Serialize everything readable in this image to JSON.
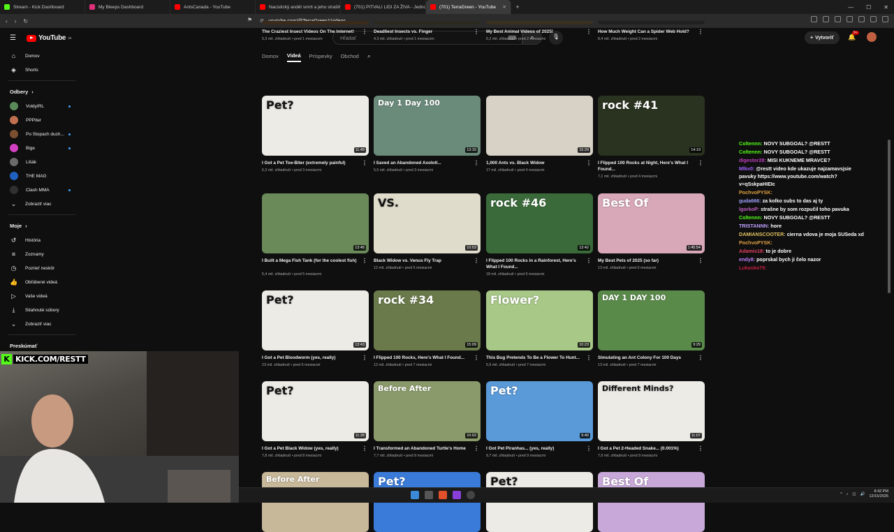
{
  "browser": {
    "tabs": [
      {
        "title": "Stream - Kick Dashboard",
        "color": "#53fc18"
      },
      {
        "title": "My Bleeps Dashboard",
        "color": "#e0307a"
      },
      {
        "title": "AntsCanada - YouTube",
        "color": "#ff0000"
      },
      {
        "title": "Nacistický anděl smrti a jeho strašlivé",
        "color": "#ff0000"
      },
      {
        "title": "(701) PITVALI LIDI ZA ŽIVA - Jednotk",
        "color": "#ff0000"
      },
      {
        "title": "(701) TerraGreen - YouTube",
        "color": "#ff0000",
        "active": true
      }
    ],
    "url": "youtube.com/@TerraGreen1/videos"
  },
  "youtube": {
    "logo_text": "YouTube",
    "logo_region": "SK",
    "search_placeholder": "Hľadať",
    "create_label": "Vytvoriť",
    "notif_count": "9+"
  },
  "sidebar": {
    "top": [
      {
        "label": "Domov",
        "icon": "home-icon",
        "glyph": "⌂"
      },
      {
        "label": "Shorts",
        "icon": "shorts-icon",
        "glyph": "◈"
      }
    ],
    "subs_header": "Odbery",
    "subs": [
      {
        "label": "VoldyIRL",
        "color": "#5a8a5a",
        "dot": true
      },
      {
        "label": "PPPiter",
        "color": "#c07050",
        "dot": false
      },
      {
        "label": "Po Stopach duch...",
        "color": "#7a5030",
        "dot": true
      },
      {
        "label": "Bige",
        "color": "#d040c0",
        "dot": true
      },
      {
        "label": "Lišák",
        "color": "#6a6a6a",
        "dot": false
      },
      {
        "label": "THE MAG",
        "color": "#2060c0",
        "dot": false
      },
      {
        "label": "Clash MMA",
        "color": "#303030",
        "dot": true
      }
    ],
    "show_more": "Zobraziť viac",
    "mine_header": "Moje",
    "mine": [
      {
        "label": "História",
        "icon": "history-icon",
        "glyph": "↺"
      },
      {
        "label": "Zoznamy",
        "icon": "playlists-icon",
        "glyph": "≡"
      },
      {
        "label": "Pozrieť neskôr",
        "icon": "watch-later-icon",
        "glyph": "◷"
      },
      {
        "label": "Obľúbené videá",
        "icon": "liked-icon",
        "glyph": "👍"
      },
      {
        "label": "Vaše videá",
        "icon": "your-videos-icon",
        "glyph": "▷"
      },
      {
        "label": "Stiahnuté súbory",
        "icon": "downloads-icon",
        "glyph": "⤓"
      }
    ],
    "show_more2": "Zobraziť viac",
    "explore_header": "Preskúmať"
  },
  "channel_tabs": [
    "Domov",
    "Videá",
    "Príspevky",
    "Obchod"
  ],
  "videos": [
    {
      "title": "The Craziest Insect Videos On The Internet!",
      "views": "5,3 mil. zhliadnutí",
      "age": "pred 1 mesiacom",
      "duration": "",
      "thumb_bg": "#3a2a1a",
      "thumb_text": ""
    },
    {
      "title": "Deadliest Insects vs. Finger",
      "views": "4,3 mil. zhliadnutí",
      "age": "pred 1 mesiacom",
      "duration": "",
      "thumb_bg": "#2a2a20",
      "thumb_text": ""
    },
    {
      "title": "My Best Animal Videos of 2025!",
      "views": "6,2 mil. zhliadnutí",
      "age": "pred 2 mesiacmi",
      "duration": "",
      "thumb_bg": "#3a3020",
      "thumb_text": ""
    },
    {
      "title": "How Much Weight Can a Spider Web Hold?",
      "views": "8,4 mil. zhliadnutí",
      "age": "pred 2 mesiacmi",
      "duration": "",
      "thumb_bg": "#202020",
      "thumb_text": ""
    },
    {
      "title": "I Got a Pet Toe-Biter (extremely painful)",
      "views": "6,3 mil. zhliadnutí",
      "age": "pred 3 mesiacmi",
      "duration": "11:49",
      "thumb_bg": "#ecebe6",
      "thumb_text": "Pet?"
    },
    {
      "title": "I Saved an Abandoned Axolotl...",
      "views": "5,5 mil. zhliadnutí",
      "age": "pred 3 mesiacmi",
      "duration": "13:15",
      "thumb_bg": "#6a8a7a",
      "thumb_text": "Day 1   Day 100"
    },
    {
      "title": "1,000 Ants vs. Black Widow",
      "views": "17 mil. zhliadnutí",
      "age": "pred 4 mesiacmi",
      "duration": "15:29",
      "thumb_bg": "#d8d2c6",
      "thumb_text": ""
    },
    {
      "title": "I Flipped 100 Rocks at Night, Here's What I Found...",
      "views": "7,1 mil. zhliadnutí",
      "age": "pred 4 mesiacmi",
      "duration": "14:19",
      "thumb_bg": "#2a3220",
      "thumb_text": "rock #41"
    },
    {
      "title": "I Built a Mega Fish Tank (for the coolest fish)",
      "views": "5,4 mil. zhliadnutí",
      "age": "pred 5 mesiacmi",
      "duration": "13:45",
      "thumb_bg": "#6a8a5a",
      "thumb_text": ""
    },
    {
      "title": "Black Widow vs. Venus Fly Trap",
      "views": "12 mil. zhliadnutí",
      "age": "pred 5 mesiacmi",
      "duration": "10:03",
      "thumb_bg": "#e0dccc",
      "thumb_text": "VS."
    },
    {
      "title": "I Flipped 100 Rocks in a Rainforest, Here's What I Found...",
      "views": "18 mil. zhliadnutí",
      "age": "pred 6 mesiacmi",
      "duration": "13:42",
      "thumb_bg": "#3a6a3a",
      "thumb_text": "rock #46"
    },
    {
      "title": "My Best Pets of 2025 (so far)",
      "views": "13 mil. zhliadnutí",
      "age": "pred 6 mesiacmi",
      "duration": "1:45:54",
      "thumb_bg": "#d8a8b8",
      "thumb_text": "Best Of"
    },
    {
      "title": "I Got a Pet Bloodworm (yes, really)",
      "views": "23 mil. zhliadnutí",
      "age": "pred 6 mesiacmi",
      "duration": "13:43",
      "thumb_bg": "#ecebe6",
      "thumb_text": "Pet?"
    },
    {
      "title": "I Flipped 100 Rocks, Here's What I Found...",
      "views": "12 mil. zhliadnutí",
      "age": "pred 7 mesiacmi",
      "duration": "15:09",
      "thumb_bg": "#6a7a4a",
      "thumb_text": "rock #34"
    },
    {
      "title": "This Bug Pretends To Be a Flower To Hunt...",
      "views": "5,9 mil. zhliadnutí",
      "age": "pred 7 mesiacmi",
      "duration": "10:23",
      "thumb_bg": "#a8c888",
      "thumb_text": "Flower?"
    },
    {
      "title": "Simulating an Ant Colony For 100 Days",
      "views": "13 mil. zhliadnutí",
      "age": "pred 7 mesiacmi",
      "duration": "9:29",
      "thumb_bg": "#5a8a4a",
      "thumb_text": "DAY 1   DAY 100"
    },
    {
      "title": "I Got a Pet Black Widow (yes, really)",
      "views": "7,8 mil. zhliadnutí",
      "age": "pred 8 mesiacmi",
      "duration": "11:28",
      "thumb_bg": "#ecebe6",
      "thumb_text": "Pet?"
    },
    {
      "title": "I Transformed an Abandoned Turtle's Home",
      "views": "7,7 mil. zhliadnutí",
      "age": "pred 9 mesiacmi",
      "duration": "10:02",
      "thumb_bg": "#8a9a6a",
      "thumb_text": "Before   After"
    },
    {
      "title": "I Got Pet Piranhas... (yes, really)",
      "views": "9,7 mil. zhliadnutí",
      "age": "pred 9 mesiacmi",
      "duration": "9:40",
      "thumb_bg": "#5a9ad8",
      "thumb_text": "Pet?"
    },
    {
      "title": "I Got a Pet 2-Headed Snake... (0.001%)",
      "views": "7,9 mil. zhliadnutí",
      "age": "pred 9 mesiacmi",
      "duration": "11:07",
      "thumb_bg": "#ecebe6",
      "thumb_text": "Different Minds?"
    },
    {
      "title": "",
      "views": "",
      "age": "",
      "duration": "",
      "thumb_bg": "#c8b89a",
      "thumb_text": "Before   After"
    },
    {
      "title": "",
      "views": "",
      "age": "",
      "duration": "",
      "thumb_bg": "#3a7ad8",
      "thumb_text": "Pet?"
    },
    {
      "title": "",
      "views": "",
      "age": "",
      "duration": "",
      "thumb_bg": "#ecebe6",
      "thumb_text": "Pet?"
    },
    {
      "title": "",
      "views": "",
      "age": "",
      "duration": "",
      "thumb_bg": "#c8a8d8",
      "thumb_text": "Best Of"
    }
  ],
  "chat": [
    {
      "user": "Coltennn:",
      "text": "NOVY SUBGOAL? @RESTT",
      "color": "#53fc18"
    },
    {
      "user": "Coltennn:",
      "text": "NOVY SUBGOAL? @RESTT",
      "color": "#53fc18"
    },
    {
      "user": "digestor28:",
      "text": "MISI KUKNEME MRAVCE?",
      "color": "#c040c0"
    },
    {
      "user": "Mlkv0:",
      "text": "@restt video kde ukazuje najzamavsjsie pavuky https://www.youtube.com/watch?v=qSskpaHIEIc",
      "color": "#a060ff"
    },
    {
      "user": "PochvoPYSK:",
      "text": "",
      "color": "#e0a040"
    },
    {
      "user": "guda666:",
      "text": "za kolko subs to das aj ty",
      "color": "#a0a0ff"
    },
    {
      "user": "lgorkoP:",
      "text": "strašne by som rozpučil toho pavuka",
      "color": "#c060c0"
    },
    {
      "user": "Coltennn:",
      "text": "NOVY SUBGOAL? @RESTT",
      "color": "#53fc18"
    },
    {
      "user": "TRISTANNN:",
      "text": "hore",
      "color": "#c0a0ff"
    },
    {
      "user": "DAMIANSCOOTER:",
      "text": "cierna vdova je moja SUSeda xd",
      "color": "#e0c060"
    },
    {
      "user": "PochvoPYSK:",
      "text": "",
      "color": "#e0a040"
    },
    {
      "user": "Adamis18:",
      "text": "to je dobre",
      "color": "#e04060"
    },
    {
      "user": "endy8:",
      "text": "poprskal bych ji čelo nazor",
      "color": "#c080ff"
    },
    {
      "user": "Lukasko79:",
      "text": "",
      "color": "#c02040"
    }
  ],
  "stream": {
    "kick_label": "KICK.COM/RESTT"
  },
  "taskbar": {
    "time": "8:42 PM",
    "date": "12/15/2025"
  }
}
